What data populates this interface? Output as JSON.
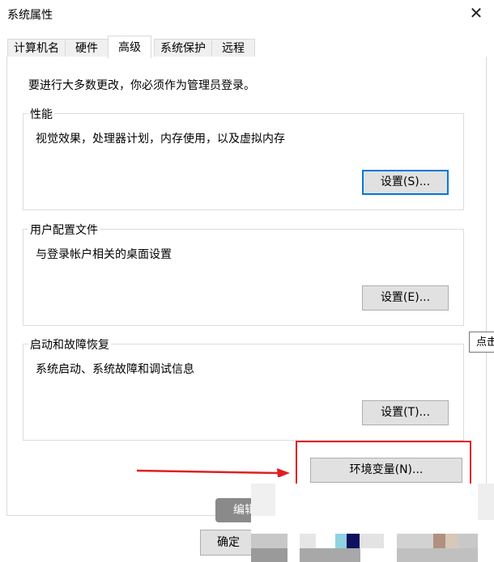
{
  "window": {
    "title": "系统属性",
    "close_glyph": "✕"
  },
  "tabs": [
    {
      "label": "计算机名"
    },
    {
      "label": "硬件"
    },
    {
      "label": "高级"
    },
    {
      "label": "系统保护"
    },
    {
      "label": "远程"
    }
  ],
  "active_tab": "高级",
  "admin_note": "要进行大多数更改，你必须作为管理员登录。",
  "groups": {
    "performance": {
      "legend": "性能",
      "description": "视觉效果，处理器计划，内存使用，以及虚拟内存",
      "button": "设置(S)..."
    },
    "user_profiles": {
      "legend": "用户配置文件",
      "description": "与登录帐户相关的桌面设置",
      "button": "设置(E)..."
    },
    "startup_recovery": {
      "legend": "启动和故障恢复",
      "description": "系统启动、系统故障和调试信息",
      "button": "设置(T)..."
    }
  },
  "env_button": "环境变量(N)...",
  "ok_button": "确定",
  "overlay": {
    "tooltip_text": "点击",
    "pill_text": "编辑",
    "highlight_color": "#e02020",
    "accent_color": "#0078d7"
  }
}
